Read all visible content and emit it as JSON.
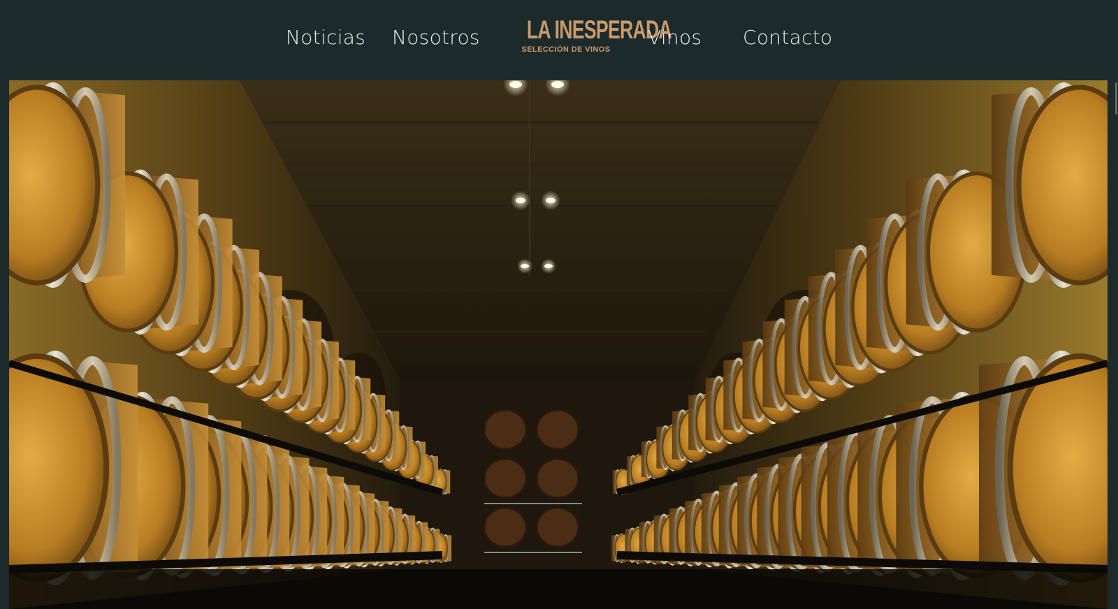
{
  "nav": {
    "items": [
      {
        "label": "Noticias"
      },
      {
        "label": "Nosotros"
      },
      {
        "label": "Vinos"
      },
      {
        "label": "Contacto"
      }
    ]
  },
  "logo": {
    "main": "LA INESPERADA",
    "sub": "SELECCIÓN DE VINOS"
  },
  "hero": {
    "image": "wine-cellar-barrel-aisle"
  },
  "colors": {
    "header_bg": "#1c2a2b",
    "nav_text": "#e9eeee",
    "logo_gold": "#c89a6c"
  }
}
